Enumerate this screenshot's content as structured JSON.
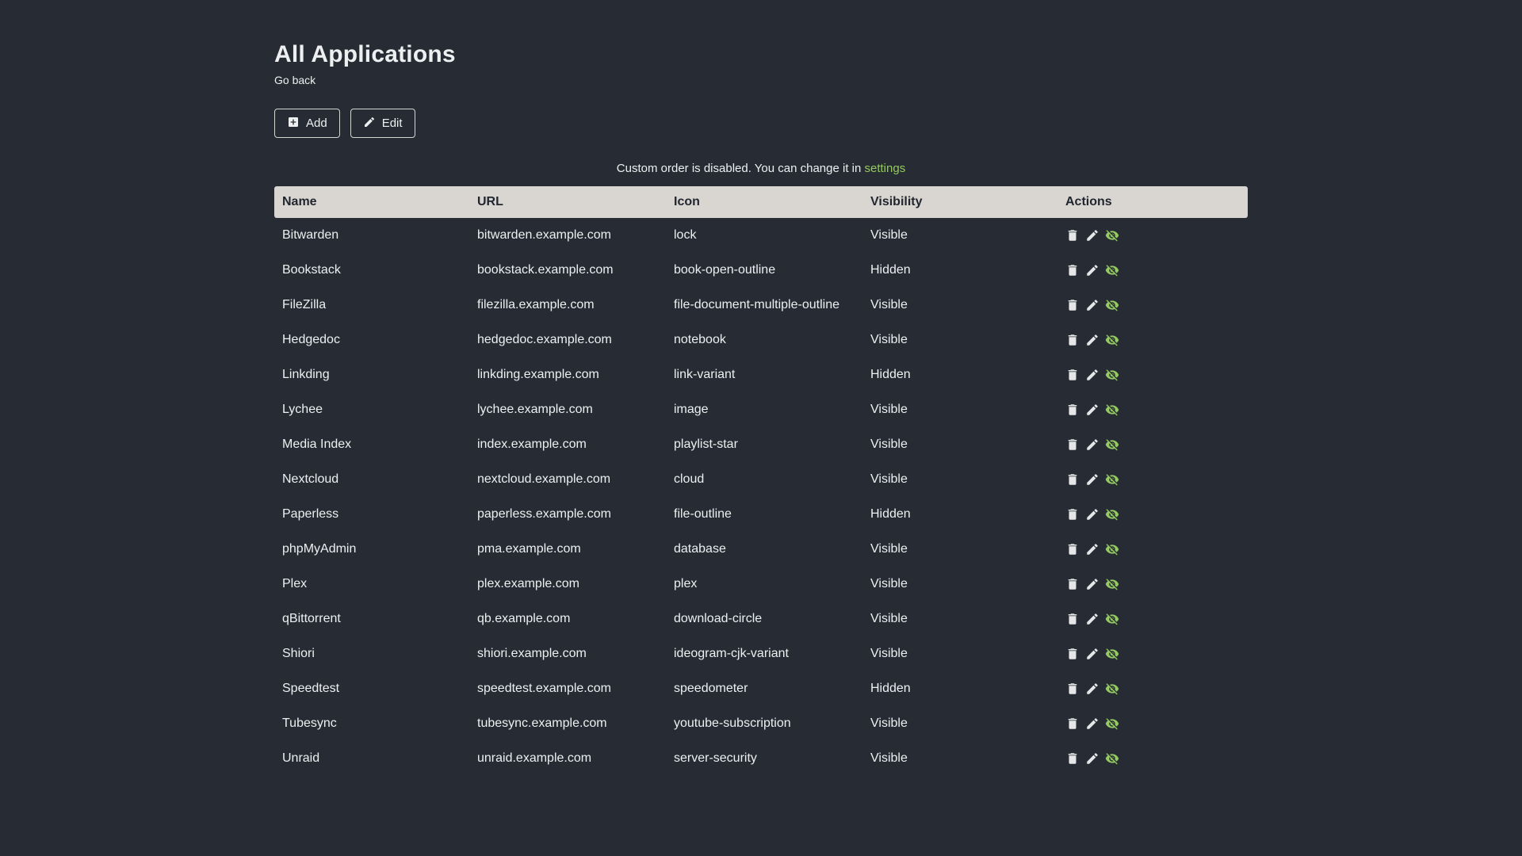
{
  "page": {
    "title": "All Applications",
    "back_link_label": "Go back",
    "notice_text": "Custom order is disabled. You can change it in",
    "notice_link_label": "settings"
  },
  "toolbar": {
    "add_label": "Add",
    "edit_label": "Edit"
  },
  "icons": {
    "add_button_icon": "plus-box-icon",
    "edit_button_icon": "pencil-icon",
    "row_delete_icon": "trash-icon",
    "row_edit_icon": "pencil-icon",
    "row_visibility_icon": "eye-off-icon"
  },
  "colors": {
    "background": "#272c34",
    "accent_green": "#94ca61",
    "table_header_bg": "#d9d6d2",
    "table_header_text": "#21262e",
    "body_text": "#edeff0"
  },
  "table": {
    "headers": [
      "Name",
      "URL",
      "Icon",
      "Visibility",
      "Actions"
    ],
    "rows": [
      {
        "name": "Bitwarden",
        "url": "bitwarden.example.com",
        "icon": "lock",
        "visibility": "Visible"
      },
      {
        "name": "Bookstack",
        "url": "bookstack.example.com",
        "icon": "book-open-outline",
        "visibility": "Hidden"
      },
      {
        "name": "FileZilla",
        "url": "filezilla.example.com",
        "icon": "file-document-multiple-outline",
        "visibility": "Visible"
      },
      {
        "name": "Hedgedoc",
        "url": "hedgedoc.example.com",
        "icon": "notebook",
        "visibility": "Visible"
      },
      {
        "name": "Linkding",
        "url": "linkding.example.com",
        "icon": "link-variant",
        "visibility": "Hidden"
      },
      {
        "name": "Lychee",
        "url": "lychee.example.com",
        "icon": "image",
        "visibility": "Visible"
      },
      {
        "name": "Media Index",
        "url": "index.example.com",
        "icon": "playlist-star",
        "visibility": "Visible"
      },
      {
        "name": "Nextcloud",
        "url": "nextcloud.example.com",
        "icon": "cloud",
        "visibility": "Visible"
      },
      {
        "name": "Paperless",
        "url": "paperless.example.com",
        "icon": "file-outline",
        "visibility": "Hidden"
      },
      {
        "name": "phpMyAdmin",
        "url": "pma.example.com",
        "icon": "database",
        "visibility": "Visible"
      },
      {
        "name": "Plex",
        "url": "plex.example.com",
        "icon": "plex",
        "visibility": "Visible"
      },
      {
        "name": "qBittorrent",
        "url": "qb.example.com",
        "icon": "download-circle",
        "visibility": "Visible"
      },
      {
        "name": "Shiori",
        "url": "shiori.example.com",
        "icon": "ideogram-cjk-variant",
        "visibility": "Visible"
      },
      {
        "name": "Speedtest",
        "url": "speedtest.example.com",
        "icon": "speedometer",
        "visibility": "Hidden"
      },
      {
        "name": "Tubesync",
        "url": "tubesync.example.com",
        "icon": "youtube-subscription",
        "visibility": "Visible"
      },
      {
        "name": "Unraid",
        "url": "unraid.example.com",
        "icon": "server-security",
        "visibility": "Visible"
      }
    ]
  }
}
